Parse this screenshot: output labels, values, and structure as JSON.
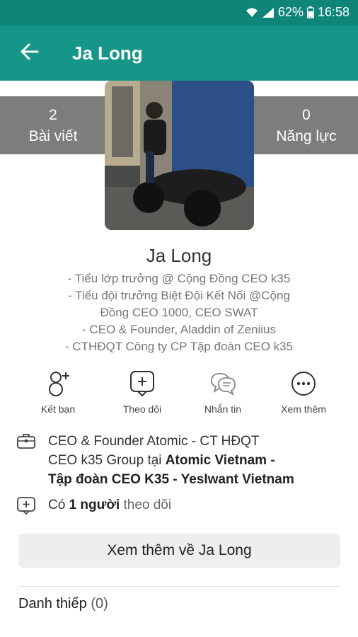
{
  "status": {
    "battery": "62%",
    "time": "16:58"
  },
  "appbar": {
    "title": "Ja Long"
  },
  "stats": {
    "posts": {
      "value": "2",
      "label": "Bài viết"
    },
    "skills": {
      "value": "0",
      "label": "Năng lực"
    }
  },
  "profile": {
    "name": "Ja Long",
    "bio": [
      "- Tiểu lớp trưởng @ Cộng Đồng CEO k35",
      "- Tiểu đội trưởng Biệt Đội Kết Nối @Cộng",
      "Đồng CEO 1000, CEO SWAT",
      "- CEO & Founder, Aladdin of Zeniius",
      "- CTHĐQT Công ty CP Tập đoàn CEO k35"
    ]
  },
  "actions": [
    {
      "label": "Kết bạn",
      "icon": "add-friend-icon"
    },
    {
      "label": "Theo dõi",
      "icon": "follow-icon"
    },
    {
      "label": "Nhắn tin",
      "icon": "message-icon"
    },
    {
      "label": "Xem thêm",
      "icon": "more-icon"
    }
  ],
  "work": {
    "icon": "briefcase-icon",
    "line1": "CEO & Founder Atomic - CT HĐQT",
    "line2_prefix": "CEO k35 Group tại ",
    "line2_bold": "Atomic Vietnam -",
    "line3_bold": "Tập đoàn CEO K35 - YesIwant Vietnam"
  },
  "followers": {
    "icon": "follow-icon",
    "prefix": "Có",
    "count_bold": "1 người",
    "suffix": "theo dõi"
  },
  "more_button": "Xem thêm về Ja Long",
  "cards": {
    "label": "Danh thiếp",
    "count": "(0)"
  }
}
